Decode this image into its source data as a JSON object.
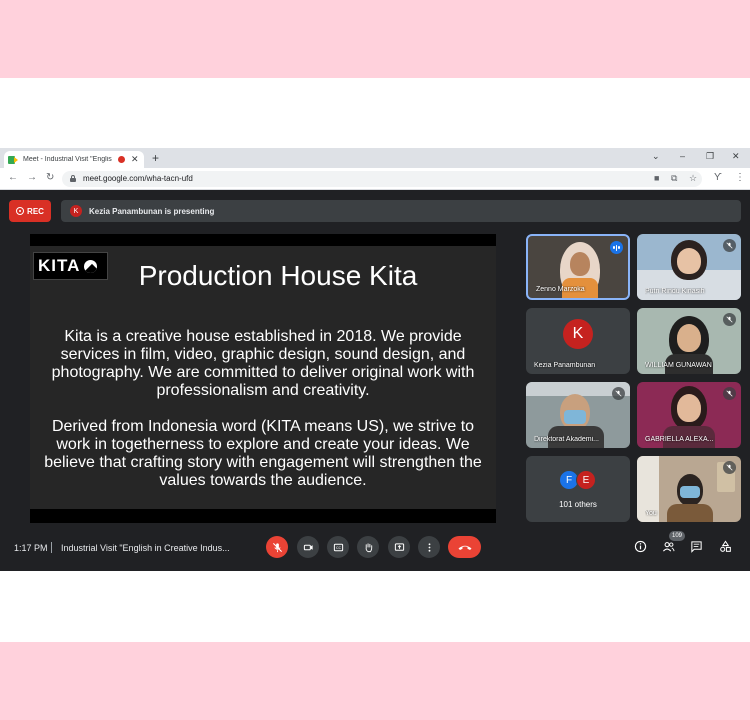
{
  "browser": {
    "tab_title": "Meet - Industrial Visit \"Englis",
    "url": "meet.google.com/wha-tacn-ufd"
  },
  "meet": {
    "rec_label": "REC",
    "presenter_initial": "K",
    "presenting_text": "Kezia Panambunan is presenting",
    "slide": {
      "logo_text": "KITA",
      "title": "Production House Kita",
      "paragraph1": "Kita is a creative house established in 2018. We provide services in film, video, graphic design, sound design, and photography. We are committed to deliver original work with professionalism and creativity.",
      "paragraph2": "Derived from Indonesia word (KITA means US), we strive to work in togetherness to explore and create your ideas. We believe that crafting story with engagement will strengthen the values towards the audience."
    },
    "participants": [
      {
        "name": "Zenno Marzoka"
      },
      {
        "name": "Putri Rindu Kinasih"
      },
      {
        "name": "Kezia Panambunan",
        "initial": "K"
      },
      {
        "name": "WILLIAM GUNAWAN"
      },
      {
        "name": "Direktorat Akademi..."
      },
      {
        "name": "GABRIELLA ALEXA..."
      },
      {
        "others_label": "101 others",
        "initials": [
          "F",
          "E"
        ]
      },
      {
        "name": "You"
      }
    ],
    "bottom": {
      "time": "1:17 PM",
      "meeting_title": "Industrial Visit \"English in Creative Indus...",
      "participant_count": "109"
    }
  },
  "colors": {
    "meet_bg": "#202124",
    "tile_bg": "#3c4043",
    "rec_red": "#d93025",
    "active_speaker": "#8ab4f8",
    "band_pink": "#ffd1dc"
  }
}
